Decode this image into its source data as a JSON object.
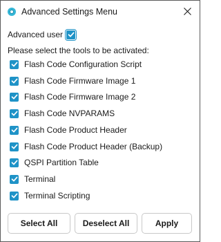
{
  "window": {
    "title": "Advanced Settings Menu",
    "icon": "app-icon",
    "close_icon": "close-icon"
  },
  "advanced_user": {
    "label": "Advanced user",
    "checked": true
  },
  "instruction": "Please select the tools to be activated:",
  "tools": [
    {
      "label": "Flash Code Configuration Script",
      "checked": true
    },
    {
      "label": "Flash Code Firmware Image 1",
      "checked": true
    },
    {
      "label": "Flash Code Firmware Image 2",
      "checked": true
    },
    {
      "label": "Flash Code NVPARAMS",
      "checked": true
    },
    {
      "label": "Flash Code Product Header",
      "checked": true
    },
    {
      "label": "Flash Code Product Header (Backup)",
      "checked": true
    },
    {
      "label": "QSPI Partition Table",
      "checked": true
    },
    {
      "label": "Terminal",
      "checked": true
    },
    {
      "label": "Terminal Scripting",
      "checked": true
    }
  ],
  "buttons": {
    "select_all": "Select All",
    "deselect_all": "Deselect All",
    "apply": "Apply"
  },
  "colors": {
    "checkbox_fill": "#1f93c7",
    "app_icon": "#35b6d6",
    "window_border": "#5a5a5a",
    "button_border": "#c8c8c8"
  }
}
